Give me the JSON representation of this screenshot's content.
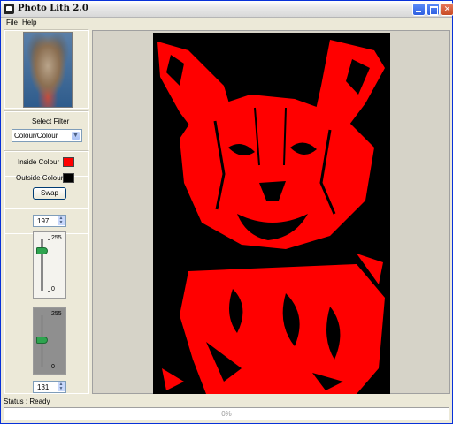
{
  "window": {
    "title": "Photo Lith 2.0"
  },
  "menu": {
    "items": [
      "File",
      "Help"
    ]
  },
  "filter": {
    "label": "Select Filter",
    "selected": "Colour/Colour"
  },
  "colours": {
    "inside_label": "Inside Colour",
    "inside_color": "#ff0000",
    "outside_label": "Outside Colour",
    "outside_color": "#000000",
    "swap_label": "Swap"
  },
  "threshold_upper": {
    "value": "197",
    "max_label": "255",
    "min_label": "0",
    "level": 197
  },
  "threshold_lower": {
    "value": "131",
    "max_label": "255",
    "min_label": "0",
    "level": 131
  },
  "status": {
    "text": "Status : Ready",
    "progress_text": "0%",
    "progress": 0
  },
  "colors": {
    "lith_fg": "#ff0000",
    "lith_bg": "#000000",
    "titlebar_btn": "#2f5fe0",
    "close_btn": "#c74b25"
  }
}
